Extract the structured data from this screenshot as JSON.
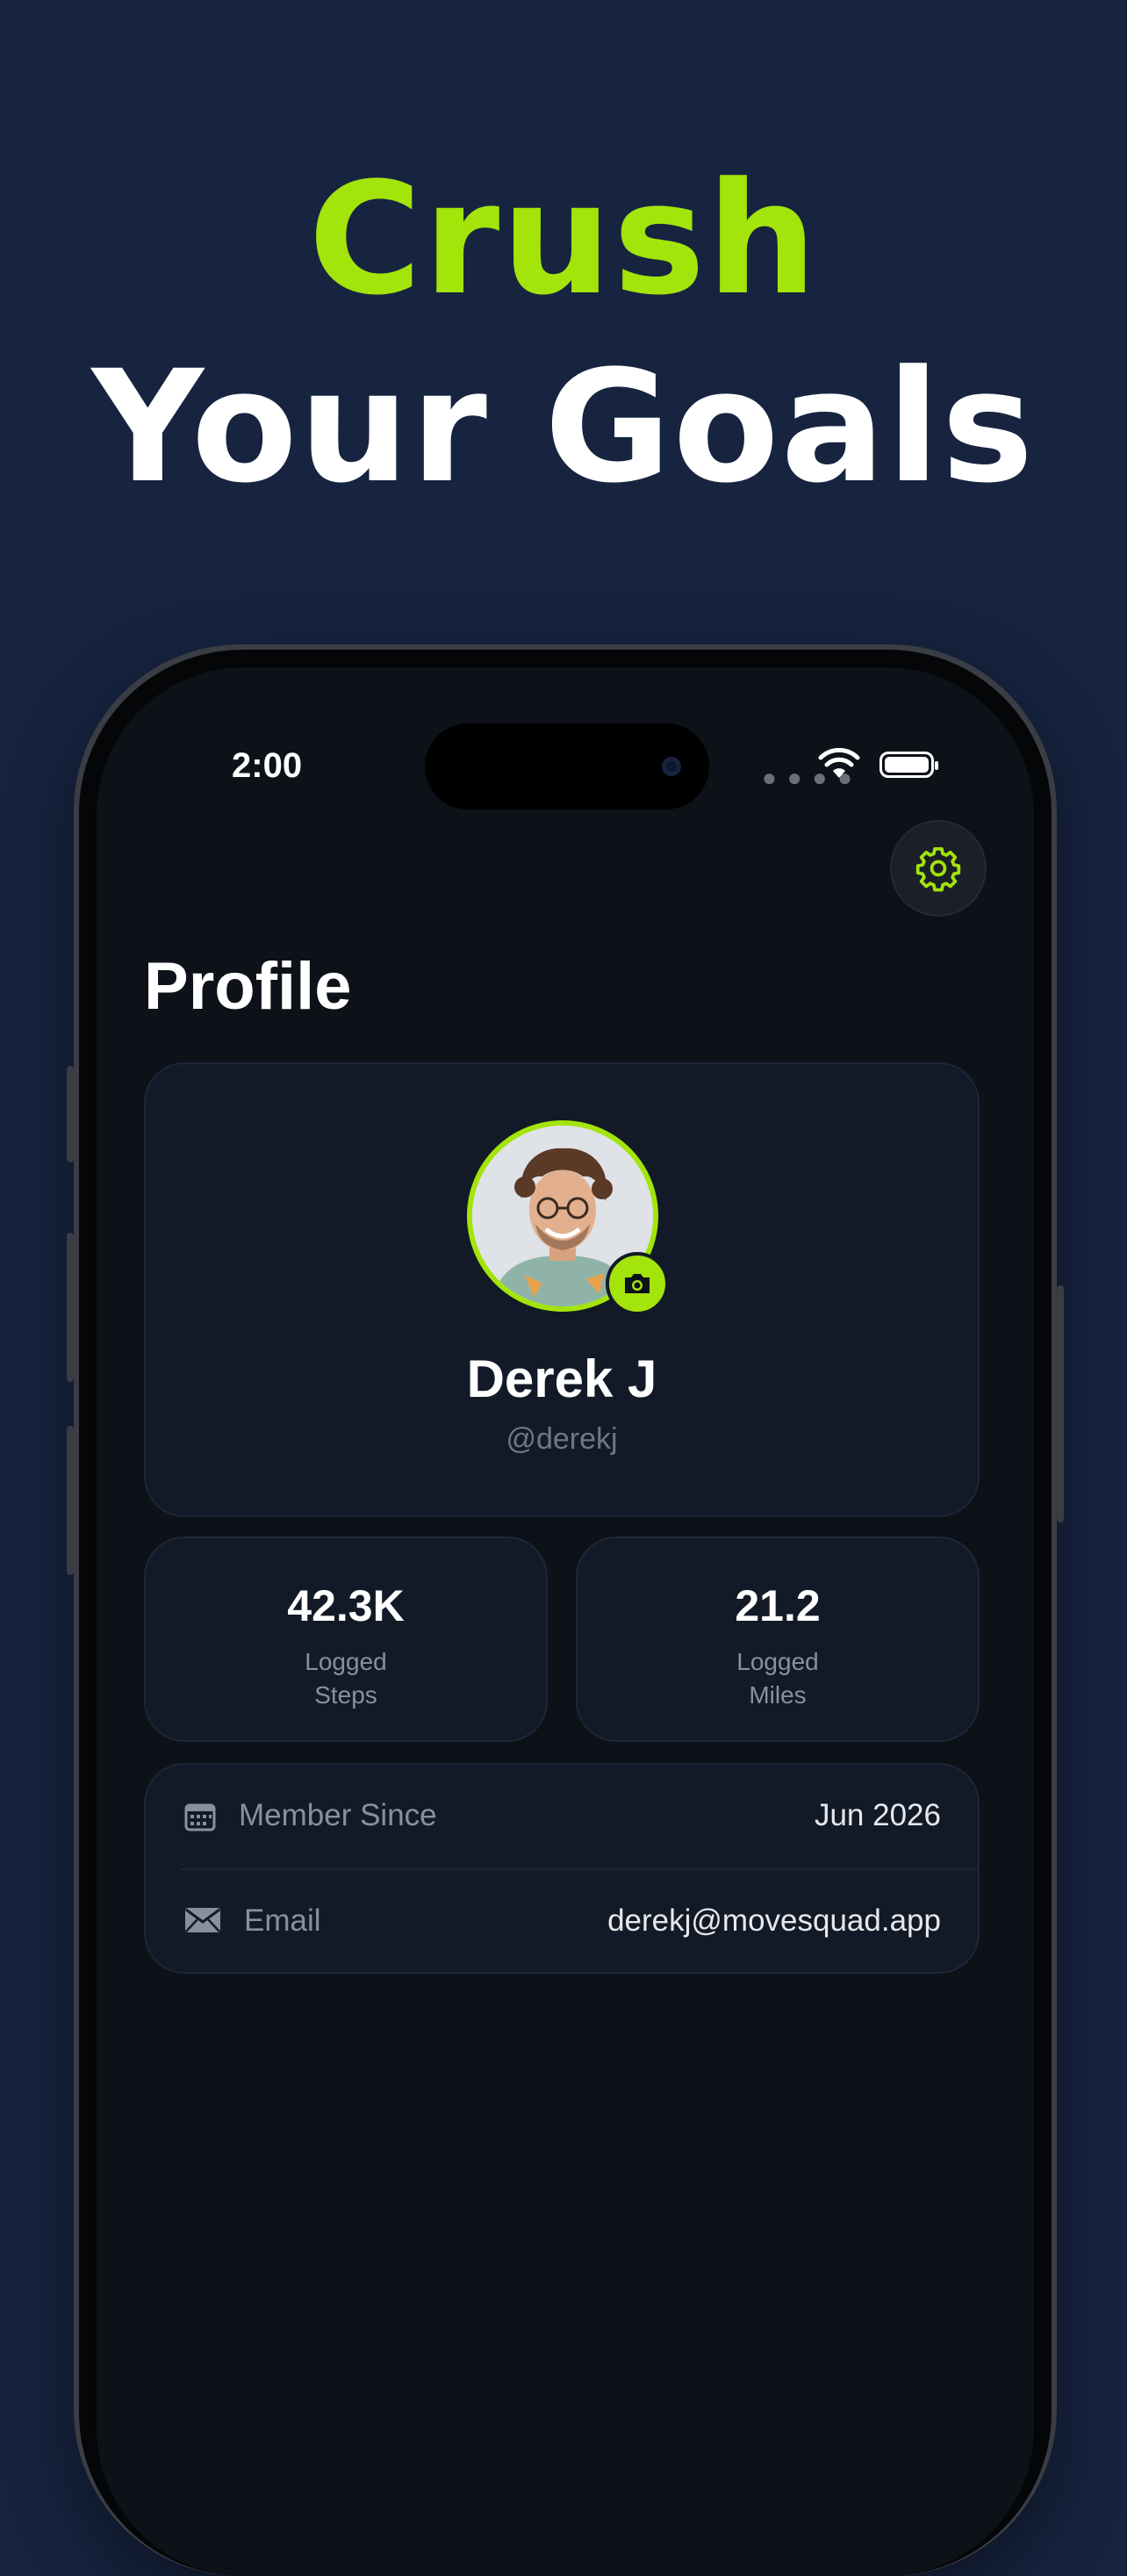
{
  "headline": {
    "line1": "Crush",
    "line2": "Your Goals"
  },
  "status_bar": {
    "time": "2:00"
  },
  "header": {
    "title": "Profile",
    "settings_icon": "gear-icon"
  },
  "profile": {
    "name": "Derek J",
    "handle": "@derekj",
    "camera_icon": "camera-icon"
  },
  "stats": [
    {
      "value": "42.3K",
      "label_line1": "Logged",
      "label_line2": "Steps"
    },
    {
      "value": "21.2",
      "label_line1": "Logged",
      "label_line2": "Miles"
    }
  ],
  "info": [
    {
      "icon": "calendar-icon",
      "label": "Member Since",
      "value": "Jun 2026"
    },
    {
      "icon": "mail-icon",
      "label": "Email",
      "value": "derekj@movesquad.app"
    }
  ],
  "colors": {
    "background": "#172440",
    "accent": "#a3e40b",
    "screen": "#0d1118",
    "card": "#131a27"
  }
}
